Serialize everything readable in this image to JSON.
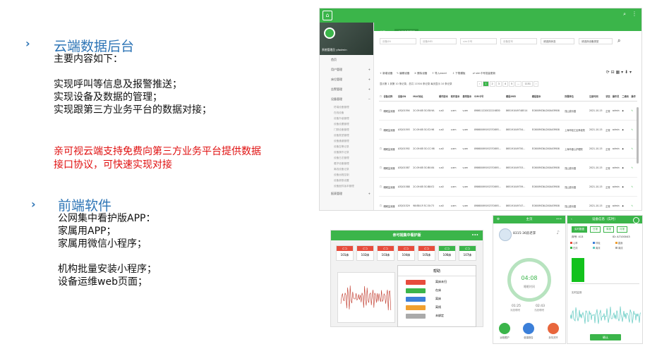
{
  "left": {
    "sections": [
      {
        "title": "云端数据后台",
        "lines": [
          "主要内容如下：",
          "",
          "实现呼叫等信息及报警推送；",
          "实现设备及数据的管理；",
          "实现跟第三方业务平台的数据对接；"
        ],
        "note": [
          "亲可视云端支持免费向第三方业务平台提供数据",
          "接口协议，可快速实现对接"
        ]
      },
      {
        "title": "前端软件",
        "lines": [
          "公网集中看护版APP：",
          "家属用APP；",
          "家属用微信小程序；",
          "",
          "机构批量安装小程序；",
          "设备运维web页面；"
        ]
      }
    ]
  },
  "admin": {
    "user": "系统管理员 yfadmin",
    "menu": [
      "首页",
      "用户管理",
      "床位管理",
      "告警管理",
      "设备管理",
      "报表管理"
    ],
    "submenu": [
      "终端设备管理",
      "在线设备",
      "设备升级管理",
      "设备设置管理",
      "门禁设备管理",
      "设备类型管理",
      "设备通道管理",
      "设备告警记录",
      "设备操作记录",
      "设备日志管理",
      "看护设备管理",
      "离线设备记录",
      "设备远程控制",
      "设备参数设置",
      "设备固件版本管理"
    ],
    "tabs": [
      "首页",
      "终端设备管理"
    ],
    "filters": [
      "设备SN",
      "设备IMEI",
      "sim卡号",
      "设备型号",
      "请选择状态",
      "请选择设备类型"
    ],
    "toolbar": [
      "+ 新增设备",
      "✎ 编辑设备",
      "✕ 删除设备",
      "⇪ 导入excel",
      "⇩ 下载模板",
      "⇄ sim卡号批量更新"
    ],
    "pagination": "显示第 1 到第 10 条记录，总共 11504 条记录 每页显示 10 条记录",
    "pages": [
      "‹",
      "1",
      "2",
      "3",
      "4",
      "5",
      "...",
      "1151",
      "›"
    ],
    "columns": [
      "设备名称",
      "设备SN",
      "MAC地址",
      "硬件版本",
      "软件版本",
      "基带版本",
      "SIM卡号",
      "模组IMEI",
      "模组版本",
      "所属单位",
      "注册时间",
      "状态",
      "操作员",
      "二维码",
      "操作"
    ],
    "rows": [
      [
        "睡眠监测器",
        "A3Q01594",
        "2C:09:8E:3C:E8:9A",
        "v.a0",
        "v.am",
        "v.am",
        "898611220022216830",
        "865191049748514",
        "EC600MCNLD00A03M08",
        "昆山康乐圆",
        "2021-10-15",
        "正常",
        "admin"
      ],
      [
        "睡眠监测器",
        "A3Q01593",
        "2C:09:8E:3C:E2:96",
        "v.a0",
        "v.am",
        "v.am",
        "89860069192370893...",
        "865191049754...",
        "EC600MCNLD00A03M08",
        "上海市松江区养老院",
        "2021-10-15",
        "正常",
        "admin"
      ],
      [
        "睡眠监测器",
        "A3Q01592",
        "2C:09:8E:3C:CC:98",
        "v.a0",
        "v.am",
        "v.am",
        "89860069192370893...",
        "865191049750...",
        "EC600MCNLD00A03M08",
        "上海市爱心护理院",
        "2021-10-15",
        "正常",
        "admin"
      ],
      [
        "睡眠监测器",
        "A3Q01587",
        "2C:09:8E:3C:B0:84",
        "v.a0",
        "v.am",
        "v.am",
        "89860069192370893...",
        "865191049753...",
        "EC600MCNLD00A03M08",
        "昆山康乐圆",
        "2021-10-15",
        "正常",
        "admin"
      ],
      [
        "睡眠监测器",
        "A3Q01588",
        "2C:09:8E:3C:B8:E2",
        "v.a0",
        "v.am",
        "v.am",
        "89860069192370893...",
        "865191049759...",
        "EC600MCNLD00A03M08",
        "昆山康乐圆",
        "2021-10-15",
        "正常",
        "admin"
      ],
      [
        "睡眠监测器",
        "A3Q01529",
        "98:BB:1F:3C:30:73",
        "v.a0",
        "v.am",
        "v.am",
        "89860069192370893...",
        "865191049747...",
        "EC600MCNLD00A03M08",
        "昆山康乐圆",
        "2021-10-15",
        "正常",
        "admin"
      ]
    ]
  },
  "phone1": {
    "title": "亲可视集中看护版",
    "beds": [
      "101床",
      "102床",
      "103床",
      "104床",
      "105床",
      "106床",
      "107床"
    ],
    "help_title": "帮助",
    "help_items": [
      {
        "label": "离床未归",
        "color": "#e74c3c"
      },
      {
        "label": "在床",
        "color": "#3bb54a"
      },
      {
        "label": "离床",
        "color": "#3b7fd9"
      },
      {
        "label": "离线",
        "color": "#f0a030"
      },
      {
        "label": "未绑定",
        "color": "#aaaaaa"
      }
    ]
  },
  "phone2": {
    "title": "主页",
    "user": "8315-36房老李",
    "time": "04:08",
    "time_label": "睡眠时间",
    "deep": "01:25",
    "deep_label": "深度睡眠",
    "light": "02:43",
    "light_label": "浅度睡眠",
    "nav": [
      "远程看护",
      "健康报告",
      "亲情关怀"
    ]
  },
  "phone3": {
    "title": "设备信息（实时）",
    "tabs": [
      "实时数据",
      "日报",
      "周报",
      "月报"
    ],
    "bed": "床号: 413",
    "id": "ID: A7100043",
    "legend": [
      "心率",
      "呼吸",
      "翻身",
      "在床",
      "离床",
      "离线"
    ],
    "chart_label": "实时监测",
    "button": "确认",
    "colors": {
      "green": "#3bb54a",
      "teal": "#5ec9c0"
    }
  }
}
